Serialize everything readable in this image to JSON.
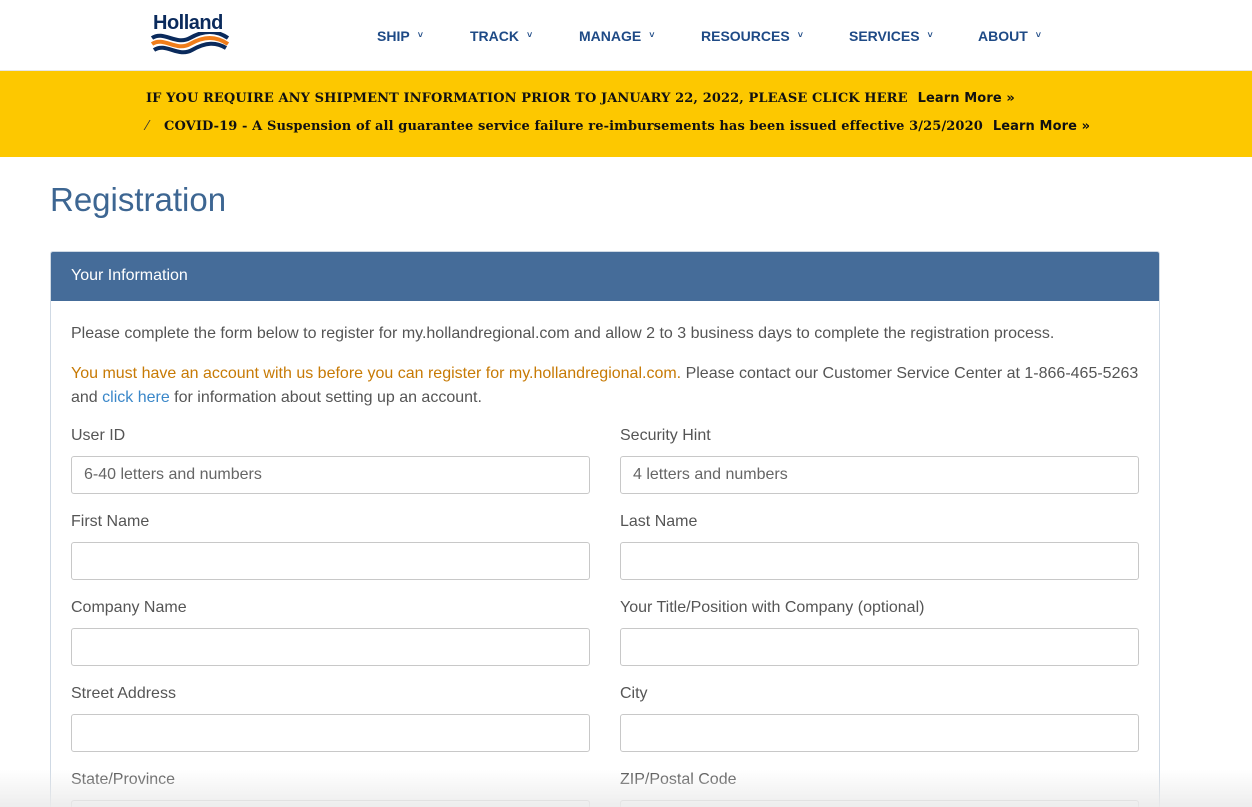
{
  "brand": {
    "name": "Holland",
    "colors": {
      "navy": "#0a2a5c",
      "orange": "#f07d1a",
      "blue": "#1e4a86"
    }
  },
  "nav": [
    {
      "label": "SHIP",
      "icon": "chevron-down-icon"
    },
    {
      "label": "TRACK",
      "icon": "chevron-down-icon"
    },
    {
      "label": "MANAGE",
      "icon": "chevron-down-icon"
    },
    {
      "label": "RESOURCES",
      "icon": "chevron-down-icon"
    },
    {
      "label": "SERVICES",
      "icon": "chevron-down-icon"
    },
    {
      "label": "ABOUT",
      "icon": "chevron-down-icon"
    }
  ],
  "banner": {
    "color": "#fdc800",
    "line1": {
      "text": "IF YOU REQUIRE ANY SHIPMENT INFORMATION PRIOR TO JANUARY 22, 2022, PLEASE CLICK HERE",
      "link": "Learn More »"
    },
    "line2": {
      "text": "COVID-19 - A Suspension of all guarantee service failure re-imbursements has been issued effective 3/25/2020",
      "link": "Learn More »"
    }
  },
  "page": {
    "title": "Registration"
  },
  "panel": {
    "heading": "Your Information",
    "intro": "Please complete the form below to register for my.hollandregional.com and allow 2 to 3 business days to complete the registration process.",
    "warning": {
      "highlight": "You must have an account with us before you can register for my.hollandregional.com.",
      "text1": " Please contact our Customer Service Center at 1-866-465-5263 and ",
      "link": "click here",
      "text2": " for information about setting up an account."
    }
  },
  "form": {
    "user_id": {
      "label": "User ID",
      "placeholder": "6-40 letters and numbers",
      "value": ""
    },
    "security_hint": {
      "label": "Security Hint",
      "placeholder": "4 letters and numbers",
      "value": ""
    },
    "first_name": {
      "label": "First Name",
      "placeholder": "",
      "value": ""
    },
    "last_name": {
      "label": "Last Name",
      "placeholder": "",
      "value": ""
    },
    "company_name": {
      "label": "Company Name",
      "placeholder": "",
      "value": ""
    },
    "title_position": {
      "label": "Your Title/Position with Company (optional)",
      "placeholder": "",
      "value": ""
    },
    "street_address": {
      "label": "Street Address",
      "placeholder": "",
      "value": ""
    },
    "city": {
      "label": "City",
      "placeholder": "",
      "value": ""
    },
    "state_province": {
      "label": "State/Province",
      "placeholder": "",
      "value": ""
    },
    "zip_postal": {
      "label": "ZIP/Postal Code",
      "placeholder": "",
      "value": ""
    }
  }
}
